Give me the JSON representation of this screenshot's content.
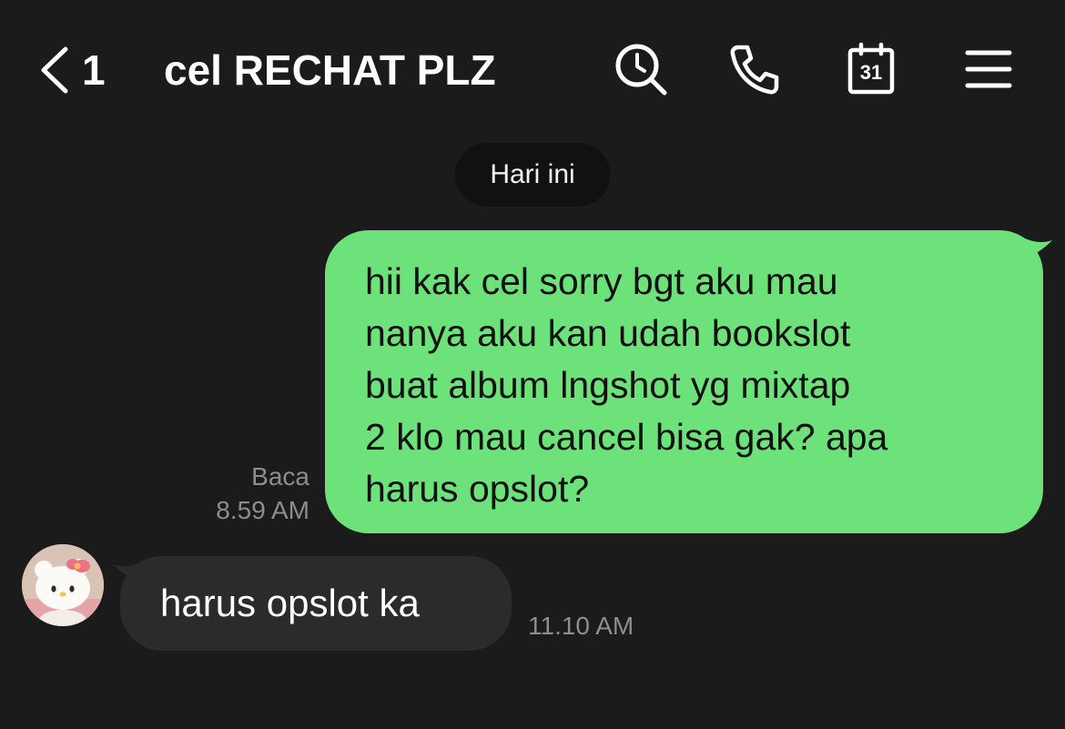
{
  "header": {
    "back_count": "1",
    "title": "cel RECHAT PLZ",
    "calendar_day": "31",
    "icons": [
      "back-chevron-icon",
      "search-icon",
      "phone-icon",
      "calendar-icon",
      "menu-icon"
    ]
  },
  "date_separator": "Hari ini",
  "messages": [
    {
      "direction": "outgoing",
      "lines": [
        "hii kak cel sorry bgt aku mau",
        "nanya aku kan udah bookslot",
        "buat album lngshot yg mixtap",
        "2 klo mau cancel bisa gak? apa",
        "harus opslot?"
      ],
      "read_label": "Baca",
      "time": "8.59 AM",
      "bubble_color": "#6ee27a"
    },
    {
      "direction": "incoming",
      "text": "harus opslot ka",
      "time": "11.10 AM",
      "bubble_color": "#2b2b2b"
    }
  ],
  "colors": {
    "background": "#1b1b1b",
    "outgoing_bubble": "#6ee27a",
    "incoming_bubble": "#2b2b2b",
    "meta_text": "#8d8d8d"
  }
}
